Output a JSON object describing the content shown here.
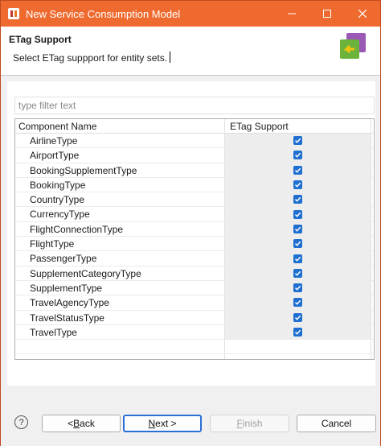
{
  "window": {
    "title": "New Service Consumption Model",
    "minimize": "—",
    "maximize": "☐",
    "close": "✕"
  },
  "header": {
    "title": "ETag Support",
    "description": "Select ETag suppport for entity sets."
  },
  "filter": {
    "placeholder": "type filter text",
    "value": ""
  },
  "table": {
    "columns": [
      "Component Name",
      "ETag Support"
    ],
    "rows": [
      {
        "name": "AirlineType",
        "checked": true
      },
      {
        "name": "AirportType",
        "checked": true
      },
      {
        "name": "BookingSupplementType",
        "checked": true
      },
      {
        "name": "BookingType",
        "checked": true
      },
      {
        "name": "CountryType",
        "checked": true
      },
      {
        "name": "CurrencyType",
        "checked": true
      },
      {
        "name": "FlightConnectionType",
        "checked": true
      },
      {
        "name": "FlightType",
        "checked": true
      },
      {
        "name": "PassengerType",
        "checked": true
      },
      {
        "name": "SupplementCategoryType",
        "checked": true
      },
      {
        "name": "SupplementType",
        "checked": true
      },
      {
        "name": "TravelAgencyType",
        "checked": true
      },
      {
        "name": "TravelStatusType",
        "checked": true
      },
      {
        "name": "TravelType",
        "checked": true
      }
    ]
  },
  "footer": {
    "help": "?",
    "back": {
      "prefix": "< ",
      "mnemonic": "B",
      "rest": "ack"
    },
    "next": {
      "mnemonic": "N",
      "rest": "ext >"
    },
    "finish": {
      "mnemonic": "F",
      "rest": "inish"
    },
    "cancel": "Cancel"
  },
  "colors": {
    "titlebar": "#ef6a2f",
    "checkbox": "#1f6fd0",
    "default_button_border": "#2a6fd6"
  }
}
